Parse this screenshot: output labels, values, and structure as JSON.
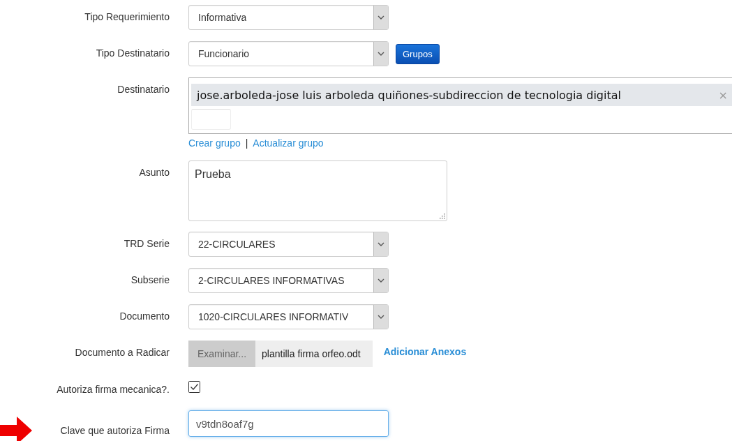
{
  "fields": [
    {
      "kind": "select",
      "label": "Tipo Requerimiento",
      "value": "Informativa"
    },
    {
      "kind": "select",
      "label": "Tipo Destinatario",
      "value": "Funcionario",
      "button": "Grupos"
    },
    {
      "kind": "tags",
      "label": "Destinatario",
      "tags": [
        "jose.arboleda-jose luis arboleda quiñones-subdireccion de tecnologia digital"
      ],
      "remove": "×",
      "links": [
        "Crear grupo",
        "|",
        "Actualizar grupo"
      ]
    },
    {
      "kind": "textarea",
      "label": "Asunto",
      "value": "Prueba"
    },
    {
      "kind": "select",
      "label": "TRD Serie",
      "value": "22-CIRCULARES"
    },
    {
      "kind": "select",
      "label": "Subserie",
      "value": "2-CIRCULARES INFORMATIVAS"
    },
    {
      "kind": "select",
      "label": "Documento",
      "value": "1020-CIRCULARES INFORMATIV"
    },
    {
      "kind": "file",
      "label": "Documento a Radicar",
      "button": "Examinar...",
      "filename": "plantilla firma orfeo.odt",
      "link": "Adicionar Anexos"
    },
    {
      "kind": "checkbox",
      "label": "Autoriza firma mecanica?.",
      "checked": true
    },
    {
      "kind": "text",
      "label": "Clave que autoriza Firma",
      "value": "v9tdn8oaf7g",
      "focused": true,
      "highlighted": true
    }
  ]
}
